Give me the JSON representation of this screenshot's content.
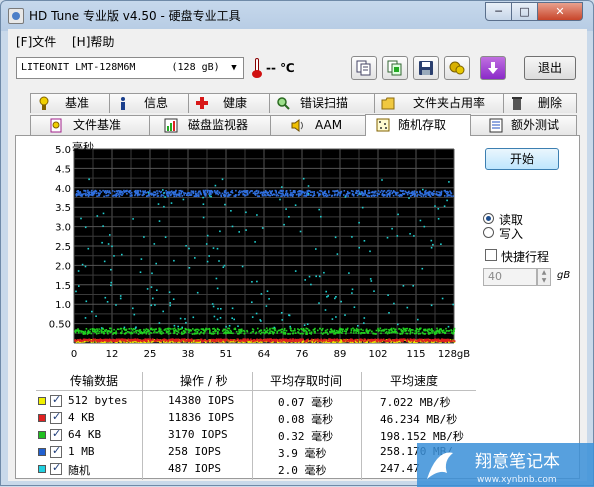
{
  "window": {
    "title": "HD Tune 专业版 v4.50 - 硬盘专业工具",
    "min_label": "─",
    "max_label": "□",
    "close_label": "✕"
  },
  "menu": [
    {
      "label": "[F]文件"
    },
    {
      "label": "[H]帮助"
    }
  ],
  "toolbar": {
    "drive": "LITEONIT LMT-128M6M      (128 gB)",
    "drive_arrow": "▼",
    "temperature": "-- ℃",
    "exit_label": "退出",
    "buttons": [
      "copy-icon",
      "copy-info-icon",
      "save-icon",
      "screenshot-icon",
      "download-icon"
    ]
  },
  "tabs_row1": [
    {
      "label": "基准",
      "icon": "benchmark-icon"
    },
    {
      "label": "信息",
      "icon": "info-icon"
    },
    {
      "label": "健康",
      "icon": "health-icon"
    },
    {
      "label": "错误扫描",
      "icon": "error-scan-icon"
    },
    {
      "label": "文件夹占用率",
      "icon": "folder-usage-icon"
    },
    {
      "label": "删除",
      "icon": "erase-icon"
    }
  ],
  "tabs_row2": [
    {
      "label": "文件基准",
      "icon": "file-benchmark-icon"
    },
    {
      "label": "磁盘监视器",
      "icon": "disk-monitor-icon"
    },
    {
      "label": "AAM",
      "icon": "speaker-icon"
    },
    {
      "label": "随机存取",
      "icon": "random-access-icon",
      "active": true
    },
    {
      "label": "额外测试",
      "icon": "extra-tests-icon"
    }
  ],
  "controls": {
    "start_label": "开始",
    "read_label": "读取",
    "write_label": "写入",
    "mode": "read",
    "fast_label": "快捷行程",
    "fast_checked": false,
    "fast_value": "40",
    "fast_unit": "gB"
  },
  "chart_data": {
    "type": "scatter",
    "ylabel": "毫秒",
    "xlabel": "",
    "y_ticks": [
      "5.0",
      "4.5",
      "4.0",
      "3.5",
      "3.0",
      "2.5",
      "2.0",
      "1.5",
      "1.0",
      "0.50"
    ],
    "x_ticks": [
      "0",
      "12",
      "25",
      "38",
      "51",
      "64",
      "76",
      "89",
      "102",
      "115",
      "128gB"
    ],
    "xlim": [
      0,
      128
    ],
    "ylim": [
      0,
      5.0
    ],
    "grid": true,
    "series": [
      {
        "name": "512 bytes",
        "color": "#e8e800",
        "band": [
          0.04,
          0.1
        ],
        "density": 0.9
      },
      {
        "name": "4 KB",
        "color": "#e02020",
        "band": [
          0.06,
          0.12
        ],
        "density": 0.9
      },
      {
        "name": "64 KB",
        "color": "#20d020",
        "band": [
          0.25,
          0.4
        ],
        "density": 0.8
      },
      {
        "name": "1 MB",
        "color": "#3070e0",
        "band": [
          3.8,
          3.95
        ],
        "density": 0.9
      },
      {
        "name": "随机",
        "color": "#20d0d0",
        "band": [
          0.4,
          4.3
        ],
        "density": 0.25
      }
    ]
  },
  "results": {
    "headers": [
      "传输数据",
      "操作 / 秒",
      "平均存取时间",
      "平均速度"
    ],
    "rows": [
      {
        "color": "#f0f000",
        "checked": true,
        "size": "512 bytes",
        "ops": "14380 IOPS",
        "time": "0.07 毫秒",
        "speed": "7.022 MB/秒"
      },
      {
        "color": "#e02020",
        "checked": true,
        "size": "4 KB",
        "ops": "11836 IOPS",
        "time": "0.08 毫秒",
        "speed": "46.234 MB/秒"
      },
      {
        "color": "#20c020",
        "checked": true,
        "size": "64 KB",
        "ops": "3170 IOPS",
        "time": "0.32 毫秒",
        "speed": "198.152 MB/秒"
      },
      {
        "color": "#2060d0",
        "checked": true,
        "size": "1 MB",
        "ops": "258 IOPS",
        "time": "3.9 毫秒",
        "speed": "258.170 MB/"
      },
      {
        "color": "#20d0e0",
        "checked": true,
        "size": "随机",
        "ops": "487 IOPS",
        "time": "2.0 毫秒",
        "speed": "247.47"
      }
    ]
  },
  "watermark": {
    "text": "翔意笔记本",
    "url": "www.xynbnb.com"
  }
}
